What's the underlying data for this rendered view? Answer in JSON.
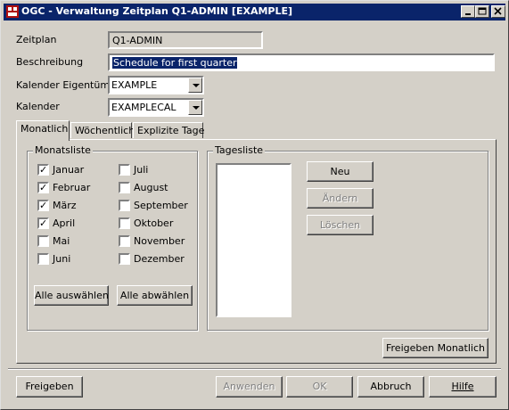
{
  "window": {
    "title": "OGC - Verwaltung Zeitplan Q1-ADMIN [EXAMPLE]",
    "colors": {
      "titlebar": "#0a246a",
      "face": "#d4d0c8",
      "selection": "#0a246a"
    }
  },
  "form": {
    "zeitplan_label": "Zeitplan",
    "zeitplan_value": "Q1-ADMIN",
    "beschreibung_label": "Beschreibung",
    "beschreibung_value": "Schedule for first quarter",
    "eigentuemer_label": "Kalender Eigentümer",
    "eigentuemer_value": "EXAMPLE",
    "kalender_label": "Kalender",
    "kalender_value": "EXAMPLECAL"
  },
  "tabs": [
    {
      "label": "Monatlich",
      "active": true
    },
    {
      "label": "Wöchentlich",
      "active": false
    },
    {
      "label": "Explizite Tage",
      "active": false
    }
  ],
  "monatsliste": {
    "title": "Monatsliste",
    "months": [
      {
        "label": "Januar",
        "checked": true
      },
      {
        "label": "Februar",
        "checked": true
      },
      {
        "label": "März",
        "checked": true
      },
      {
        "label": "April",
        "checked": true
      },
      {
        "label": "Mai",
        "checked": false
      },
      {
        "label": "Juni",
        "checked": false
      },
      {
        "label": "Juli",
        "checked": false
      },
      {
        "label": "August",
        "checked": false
      },
      {
        "label": "September",
        "checked": false
      },
      {
        "label": "Oktober",
        "checked": false
      },
      {
        "label": "November",
        "checked": false
      },
      {
        "label": "Dezember",
        "checked": false
      }
    ],
    "select_all": "Alle auswählen",
    "deselect_all": "Alle abwählen"
  },
  "tagesliste": {
    "title": "Tagesliste",
    "new": "Neu",
    "change": "Ändern",
    "delete": "Löschen"
  },
  "release_monthly": "Freigeben Monatlich",
  "footer": {
    "release": "Freigeben",
    "apply": "Anwenden",
    "ok": "OK",
    "cancel": "Abbruch",
    "help": "Hilfe"
  }
}
